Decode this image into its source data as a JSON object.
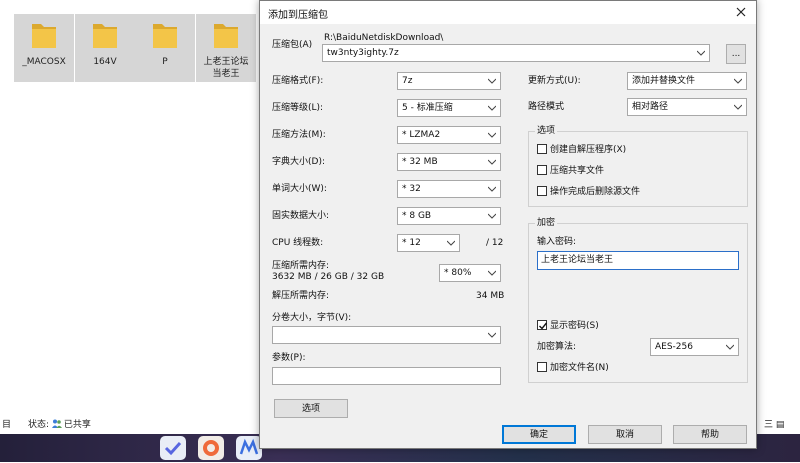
{
  "explorer": {
    "folders": [
      {
        "label": "_MACOSX"
      },
      {
        "label": "164V"
      },
      {
        "label": "P"
      },
      {
        "label": "上老王论坛当老王"
      }
    ],
    "status_left": "目",
    "status_state_label": "状态:",
    "status_shared": "已共享",
    "status_right": "三 ▤"
  },
  "colors": {
    "folder_yellow": "#f3c548",
    "folder_dark": "#dca92e",
    "accent_blue": "#0078d7"
  },
  "dialog": {
    "title": "添加到压缩包",
    "archive_label": "压缩包(A)",
    "archive_path": "R:\\BaiduNetdiskDownload\\",
    "archive_name": "tw3nty3ighty.7z",
    "browse_label": "...",
    "format_label": "压缩格式(F):",
    "format_value": "7z",
    "level_label": "压缩等级(L):",
    "level_value": "5 - 标准压缩",
    "method_label": "压缩方法(M):",
    "method_value": "* LZMA2",
    "dict_label": "字典大小(D):",
    "dict_value": "* 32 MB",
    "word_label": "单词大小(W):",
    "word_value": "* 32",
    "solid_label": "固实数据大小:",
    "solid_value": "* 8 GB",
    "cpu_label": "CPU 线程数:",
    "cpu_value": "* 12",
    "cpu_total": "/ 12",
    "mem_label": "压缩所需内存:",
    "mem_detail": "3632 MB / 26 GB / 32 GB",
    "mem_value": "* 80%",
    "decomp_label": "解压所需内存:",
    "decomp_value": "34 MB",
    "split_label": "分卷大小，字节(V):",
    "split_value": "",
    "params_label": "参数(P):",
    "params_value": "",
    "options_button": "选项",
    "update_label": "更新方式(U):",
    "update_value": "添加并替换文件",
    "path_label": "路径模式",
    "path_value": "相对路径",
    "options_group": "选项",
    "opt_sfx": "创建自解压程序(X)",
    "opt_shared": "压缩共享文件",
    "opt_delete": "操作完成后删除源文件",
    "encrypt_group": "加密",
    "password_label": "输入密码:",
    "password_value": "上老王论坛当老王",
    "show_password": "显示密码(S)",
    "algo_label": "加密算法:",
    "algo_value": "AES-256",
    "encrypt_names": "加密文件名(N)",
    "ok": "确定",
    "cancel": "取消",
    "help": "帮助"
  }
}
